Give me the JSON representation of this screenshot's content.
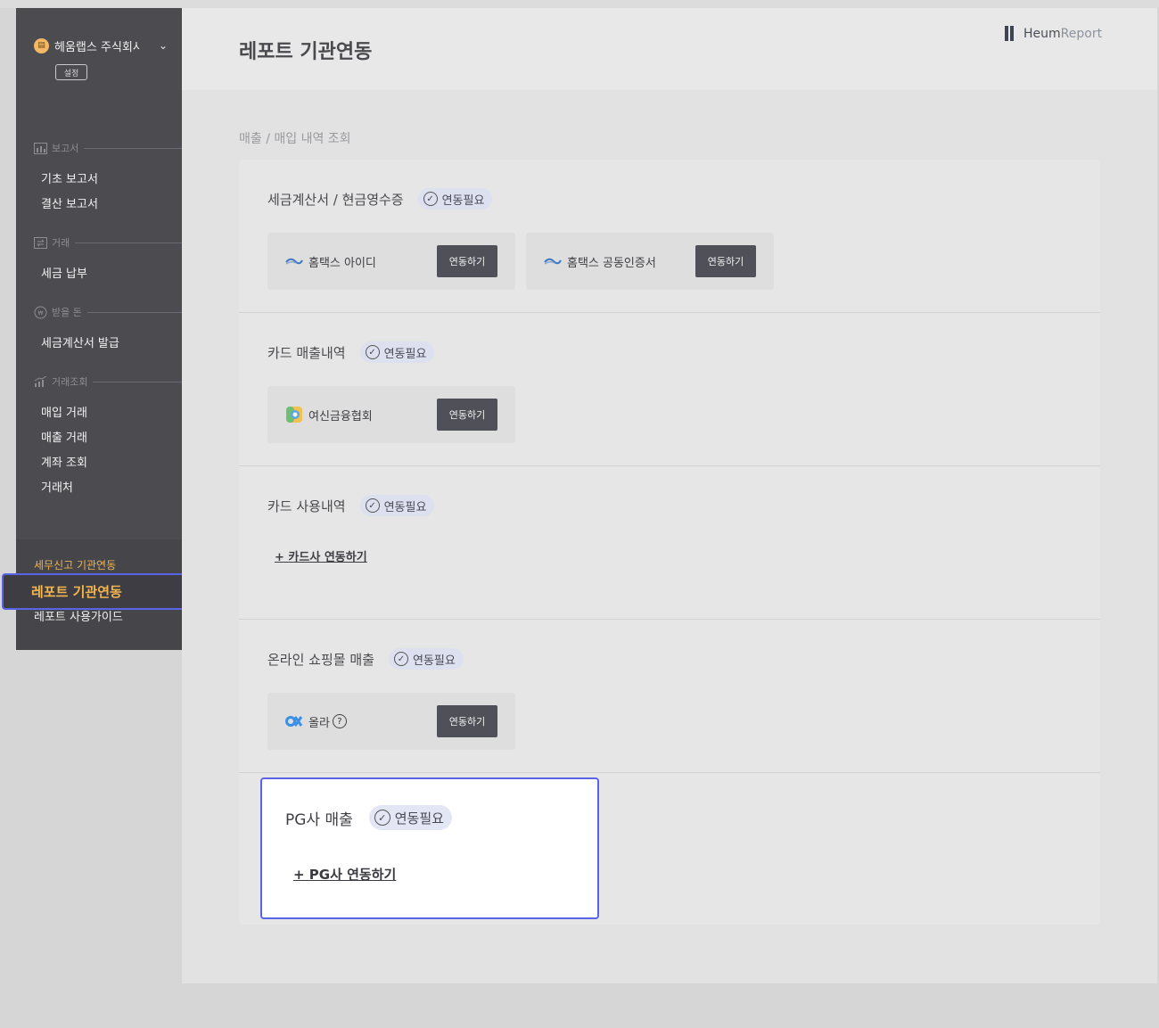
{
  "sidebar": {
    "company_name": "헤움랩스 주식회사",
    "settings_label": "설정",
    "sections": [
      {
        "label": "보고서",
        "items": [
          "기초 보고서",
          "결산 보고서"
        ]
      },
      {
        "label": "거래",
        "items": [
          "세금 납부"
        ]
      },
      {
        "label": "받을 돈",
        "items": [
          "세금계산서 발급"
        ]
      },
      {
        "label": "거래조회",
        "items": [
          "매입 거래",
          "매출 거래",
          "계좌 조회",
          "거래처"
        ]
      }
    ],
    "tax_link": "세무신고 기관연동",
    "active_item": "레포트 기관연동",
    "guide_link": "레포트 사용가이드"
  },
  "header": {
    "title": "레포트 기관연동",
    "brand_heum": "Heum",
    "brand_report": "Report"
  },
  "main": {
    "subtitle": "매출 / 매입 내역 조회",
    "status_badge": "연동필요",
    "connect_label": "연동하기",
    "sections": [
      {
        "title": "세금계산서 / 현금영수증",
        "cards": [
          "홈택스 아이디",
          "홈택스 공동인증서"
        ]
      },
      {
        "title": "카드 매출내역",
        "cards": [
          "여신금융협회"
        ]
      },
      {
        "title": "카드 사용내역",
        "link": "+ 카드사 연동하기"
      },
      {
        "title": "온라인 쇼핑몰 매출",
        "cards": [
          "올라"
        ]
      },
      {
        "title": "PG사 매출",
        "link": "+ PG사 연동하기"
      }
    ]
  },
  "colors": {
    "accent": "#5a64e6",
    "active_text": "#f3b64d",
    "sidebar_bg": "#4b4b50"
  }
}
